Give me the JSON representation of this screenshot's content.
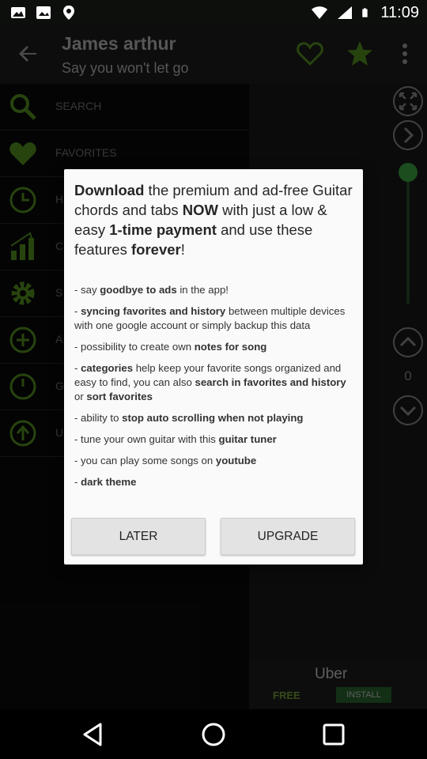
{
  "status_bar": {
    "time": "11:09"
  },
  "header": {
    "title": "James arthur",
    "subtitle": "Say you won't let go"
  },
  "drawer": {
    "items": [
      {
        "label": "SEARCH",
        "icon": "search-icon"
      },
      {
        "label": "FAVORITES",
        "icon": "heart-icon"
      },
      {
        "label": "H",
        "icon": "clock-icon"
      },
      {
        "label": "C",
        "icon": "chart-icon"
      },
      {
        "label": "S",
        "icon": "gear-icon"
      },
      {
        "label": "A",
        "icon": "add-circle-icon"
      },
      {
        "label": "G",
        "icon": "tuner-icon"
      },
      {
        "label": "U",
        "icon": "upload-icon"
      }
    ]
  },
  "side_panel": {
    "count": "0"
  },
  "ad": {
    "title": "Uber",
    "free_label": "FREE",
    "install_label": "INSTALL"
  },
  "dialog": {
    "headline": {
      "part1": "Download",
      "part2": " the premium and ad-free Guitar chords and tabs ",
      "part3": "NOW",
      "part4": " with just a low & easy ",
      "part5": "1-time payment",
      "part6": " and use these features ",
      "part7": "forever",
      "part8": "!"
    },
    "features": [
      {
        "pre": "- say ",
        "bold": "goodbye to ads",
        "post": " in the app!"
      },
      {
        "pre": "- ",
        "bold": "syncing favorites and history",
        "post": " between multiple devices with one google account or simply backup this data"
      },
      {
        "pre": "- possibility to create own ",
        "bold": "notes for song",
        "post": ""
      },
      {
        "pre": "- ",
        "bold": "categories",
        "post": " help keep your favorite songs organized and easy to find, you can also ",
        "bold2": "search in favorites and history",
        "post2": " or ",
        "bold3": "sort favorites",
        "post3": ""
      },
      {
        "pre": "- ability to ",
        "bold": "stop auto scrolling when not playing",
        "post": ""
      },
      {
        "pre": "- tune your own guitar with this ",
        "bold": "guitar tuner",
        "post": ""
      },
      {
        "pre": "- you can play some songs on ",
        "bold": "youtube",
        "post": ""
      },
      {
        "pre": "- ",
        "bold": "dark theme",
        "post": ""
      }
    ],
    "later_label": "LATER",
    "upgrade_label": "UPGRADE"
  },
  "colors": {
    "accent_green": "#5ea11f",
    "dialog_bg": "#fafafa",
    "button_bg": "#e3e3e3"
  }
}
